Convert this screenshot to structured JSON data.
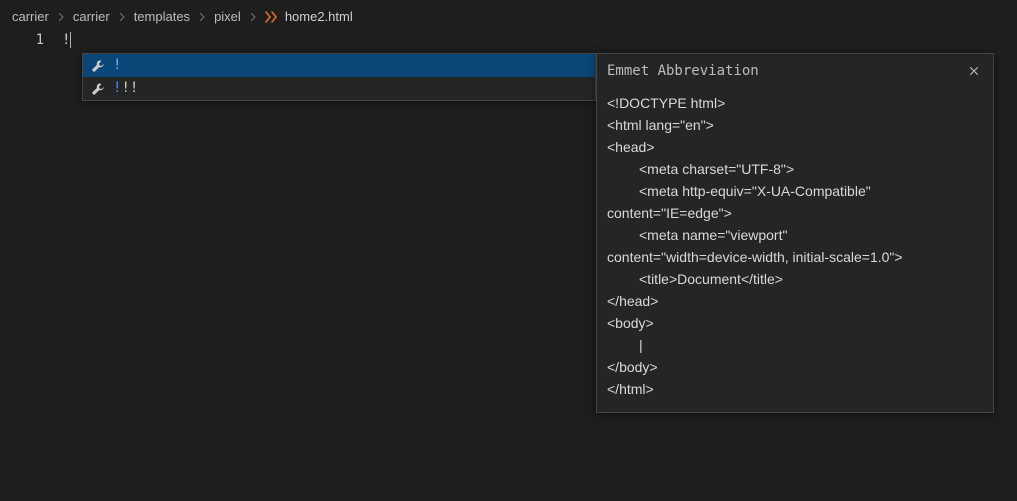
{
  "breadcrumb": {
    "items": [
      "carrier",
      "carrier",
      "templates",
      "pixel"
    ],
    "filename": "home2.html"
  },
  "editor": {
    "line_number": "1",
    "content": "!"
  },
  "suggestions": {
    "item1": "!",
    "item2_hl": "!",
    "item2_rest": "!!"
  },
  "doc": {
    "title": "Emmet Abbreviation",
    "lines": {
      "l0": "<!DOCTYPE html>",
      "l1": "<html lang=\"en\">",
      "l2": "<head>",
      "l3": "<meta charset=\"UTF-8\">",
      "l4": "<meta http-equiv=\"X-UA-Compatible\"",
      "l4b": "content=\"IE=edge\">",
      "l5": "<meta name=\"viewport\"",
      "l5b": "content=\"width=device-width, initial-scale=1.0\">",
      "l6": "<title>Document</title>",
      "l7": "</head>",
      "l8": "<body>",
      "l9": "|",
      "l10": "</body>",
      "l11": "</html>"
    }
  }
}
